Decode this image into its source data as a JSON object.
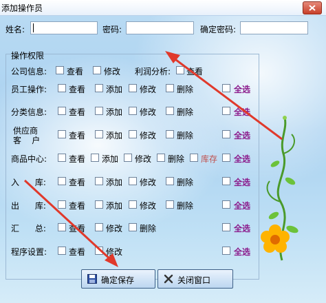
{
  "window": {
    "title": "添加操作员"
  },
  "form": {
    "name_label": "姓名:",
    "name_value": "",
    "password_label": "密码:",
    "password_value": "",
    "confirm_label": "确定密码:",
    "confirm_value": ""
  },
  "permissions": {
    "legend": "操作权限",
    "rows": [
      {
        "label": "公司信息:",
        "items": [
          "查看",
          "修改"
        ],
        "extra_label": "利润分析:",
        "extra_item": "查看"
      },
      {
        "label": "员工操作:",
        "items": [
          "查看",
          "添加",
          "修改",
          "删除"
        ],
        "select_all": "全选"
      },
      {
        "label": "分类信息:",
        "items": [
          "查看",
          "添加",
          "修改",
          "删除"
        ],
        "select_all": "全选"
      },
      {
        "label_line1": "供应商",
        "label_line2": "客    户",
        "items": [
          "查看",
          "添加",
          "修改",
          "删除"
        ],
        "select_all": "全选"
      },
      {
        "label": "商品中心:",
        "items": [
          "查看",
          "添加",
          "修改",
          "删除",
          "库存"
        ],
        "select_all": "全选"
      },
      {
        "label": "入      库:",
        "items": [
          "查看",
          "添加",
          "修改",
          "删除"
        ],
        "select_all": "全选"
      },
      {
        "label": "出      库:",
        "items": [
          "查看",
          "添加",
          "修改",
          "删除"
        ],
        "select_all": "全选"
      },
      {
        "label": "汇      总:",
        "items": [
          "查看",
          "修改",
          "删除"
        ],
        "select_all": "全选"
      },
      {
        "label": "程序设置:",
        "items": [
          "查看",
          "修改"
        ],
        "select_all": "全选"
      }
    ]
  },
  "buttons": {
    "save": "确定保存",
    "close": "关闭窗口"
  },
  "icons": [
    "close-icon",
    "save-icon",
    "x-icon",
    "flower-vine-icon"
  ],
  "colors": {
    "select_all": "#8b1a8b",
    "stock": "#c0504d",
    "arrow": "#e0392b"
  }
}
